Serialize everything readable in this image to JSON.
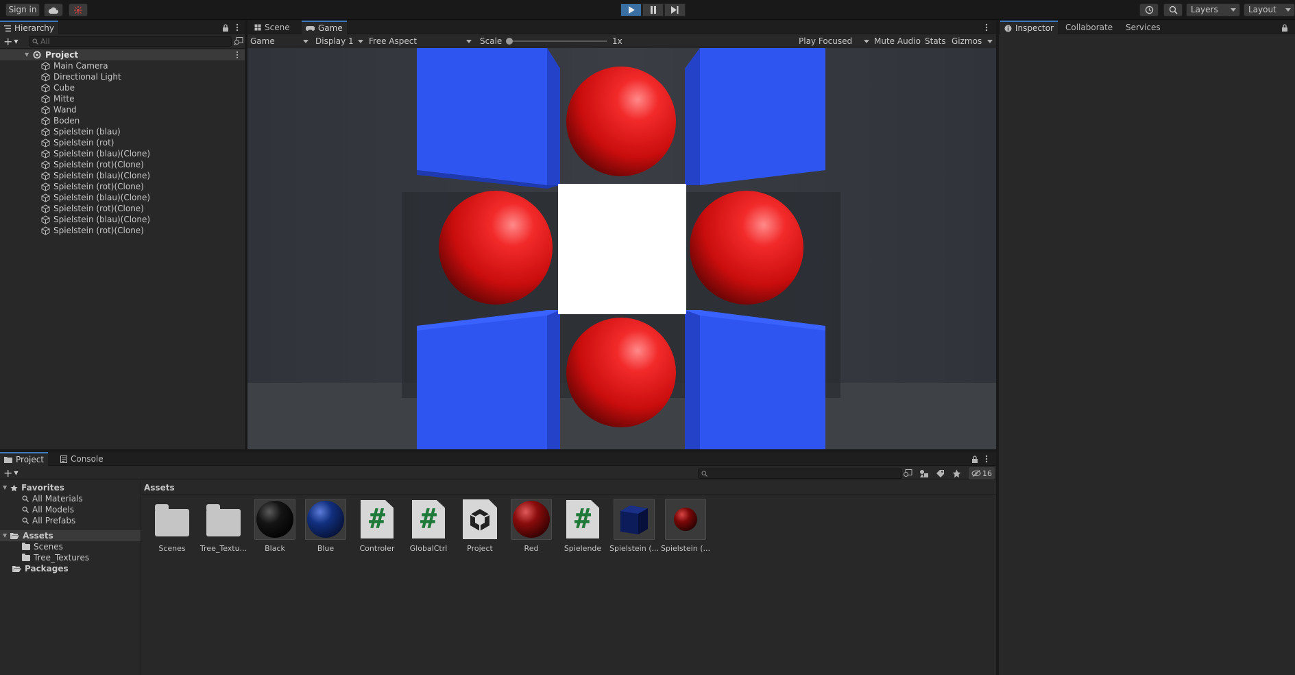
{
  "toolbar": {
    "sign_in": "Sign in",
    "layers": "Layers",
    "layout": "Layout"
  },
  "hierarchy": {
    "tab": "Hierarchy",
    "search_placeholder": "All",
    "root": "Project",
    "items": [
      "Main Camera",
      "Directional Light",
      "Cube",
      "Mitte",
      "Wand",
      "Boden",
      "Spielstein (blau)",
      "Spielstein (rot)",
      "Spielstein (blau)(Clone)",
      "Spielstein (rot)(Clone)",
      "Spielstein (blau)(Clone)",
      "Spielstein (rot)(Clone)",
      "Spielstein (blau)(Clone)",
      "Spielstein (rot)(Clone)",
      "Spielstein (blau)(Clone)",
      "Spielstein (rot)(Clone)"
    ]
  },
  "gameview": {
    "tabs": [
      "Scene",
      "Game"
    ],
    "game_dropdown": "Game",
    "display": "Display 1",
    "aspect": "Free Aspect",
    "scale_label": "Scale",
    "scale_value": "1x",
    "play_focused": "Play Focused",
    "mute_audio": "Mute Audio",
    "stats": "Stats",
    "gizmos": "Gizmos"
  },
  "inspector": {
    "tabs": [
      "Inspector",
      "Collaborate",
      "Services"
    ]
  },
  "project": {
    "tabs": [
      "Project",
      "Console"
    ],
    "hidden_count": "16",
    "favorites": "Favorites",
    "favorite_items": [
      "All Materials",
      "All Models",
      "All Prefabs"
    ],
    "assets_root": "Assets",
    "asset_folders": [
      "Scenes",
      "Tree_Textures"
    ],
    "packages": "Packages",
    "assets_header": "Assets",
    "assets": [
      {
        "label": "Scenes",
        "kind": "folder"
      },
      {
        "label": "Tree_Textu...",
        "kind": "folder"
      },
      {
        "label": "Black",
        "kind": "material",
        "color": "#0b0b0b"
      },
      {
        "label": "Blue",
        "kind": "material",
        "color": "#10287a"
      },
      {
        "label": "Controler",
        "kind": "script"
      },
      {
        "label": "GlobalCtrl",
        "kind": "script"
      },
      {
        "label": "Project",
        "kind": "scene"
      },
      {
        "label": "Red",
        "kind": "material",
        "color": "#8a0c0c"
      },
      {
        "label": "Spielende",
        "kind": "script"
      },
      {
        "label": "Spielstein (...",
        "kind": "prefab-cube"
      },
      {
        "label": "Spielstein (...",
        "kind": "prefab-sphere"
      }
    ]
  },
  "colors": {
    "accent": "#3a79bb",
    "play_active": "#3a6fa3",
    "cube_blue": "#2f55f0",
    "sphere_red": "#e01a1a"
  }
}
